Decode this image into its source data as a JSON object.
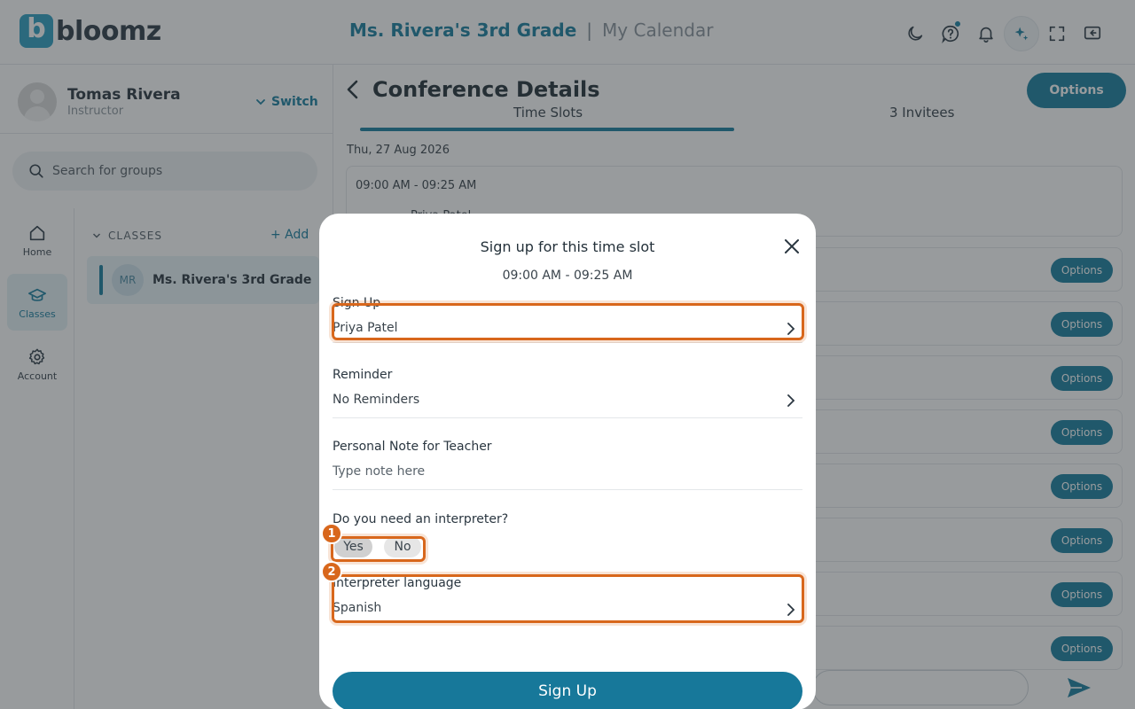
{
  "header": {
    "logo_letter": "b",
    "logo_text": "bloomz",
    "class_title": "Ms. Rivera's 3rd Grade",
    "separator": "|",
    "page_name": "My Calendar"
  },
  "profile": {
    "name": "Tomas Rivera",
    "role": "Instructor",
    "switch_label": "Switch"
  },
  "search": {
    "placeholder": "Search for groups"
  },
  "nav": {
    "home": "Home",
    "classes": "Classes",
    "account": "Account"
  },
  "classes": {
    "heading": "CLASSES",
    "add_label": "+ Add",
    "items": [
      {
        "initials": "MR",
        "name": "Ms. Rivera's 3rd Grade"
      }
    ]
  },
  "main": {
    "title": "Conference Details",
    "options_label": "Options",
    "tabs": [
      "Time Slots",
      "3 Invitees"
    ],
    "date": "Thu, 27 Aug 2026",
    "first_slot_time": "09:00 AM - 09:25 AM",
    "first_slot_person": "Priya Patel",
    "row_option_label": "Options"
  },
  "modal": {
    "title": "Sign up for this time slot",
    "time": "09:00 AM - 09:25 AM",
    "signup_label": "Sign Up",
    "signup_value": "Priya Patel",
    "reminder_label": "Reminder",
    "reminder_value": "No Reminders",
    "note_label": "Personal Note for Teacher",
    "note_placeholder": "Type note here",
    "interpreter_question": "Do you need an interpreter?",
    "yes_label": "Yes",
    "no_label": "No",
    "interpreter_selected": "Yes",
    "language_label": "Interpreter language",
    "language_value": "Spanish",
    "submit_label": "Sign Up"
  },
  "annotations": {
    "badge_1": "1",
    "badge_2": "2"
  },
  "colors": {
    "accent": "#1a7fa0",
    "highlight": "#d8671c",
    "overlay": "rgba(40,45,50,0.48)"
  }
}
